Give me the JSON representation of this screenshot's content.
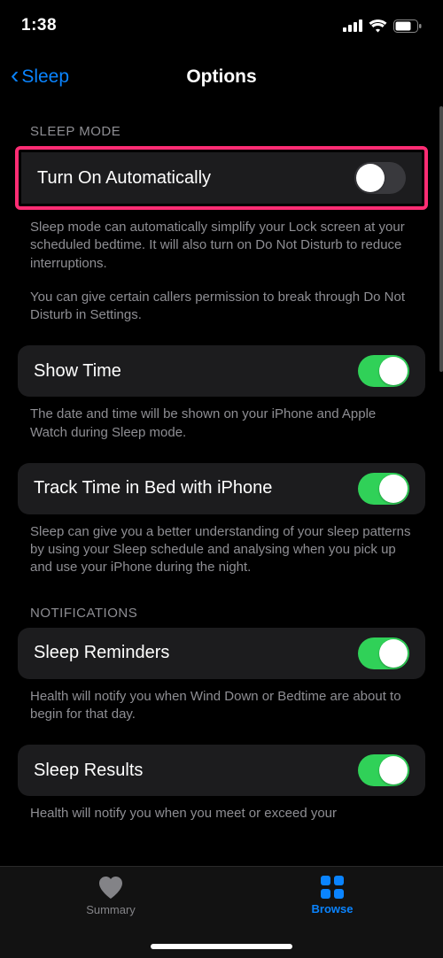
{
  "status": {
    "time": "1:38"
  },
  "nav": {
    "back_label": "Sleep",
    "title": "Options"
  },
  "sections": {
    "sleep_mode": {
      "header": "SLEEP MODE",
      "auto": {
        "label": "Turn On Automatically",
        "on": false
      },
      "auto_footer1": "Sleep mode can automatically simplify your Lock screen at your scheduled bedtime. It will also turn on Do Not Disturb to reduce interruptions.",
      "auto_footer2": "You can give certain callers permission to break through Do Not Disturb in Settings.",
      "show_time": {
        "label": "Show Time",
        "on": true
      },
      "show_time_footer": "The date and time will be shown on your iPhone and Apple Watch during Sleep mode.",
      "track": {
        "label": "Track Time in Bed with iPhone",
        "on": true
      },
      "track_footer": "Sleep can give you a better understanding of your sleep patterns by using your Sleep schedule and analysing when you pick up and use your iPhone during the night."
    },
    "notifications": {
      "header": "NOTIFICATIONS",
      "reminders": {
        "label": "Sleep Reminders",
        "on": true
      },
      "reminders_footer": "Health will notify you when Wind Down or Bedtime are about to begin for that day.",
      "results": {
        "label": "Sleep Results",
        "on": true
      },
      "results_footer": "Health will notify you when you meet or exceed your"
    }
  },
  "tabs": {
    "summary": "Summary",
    "browse": "Browse"
  }
}
